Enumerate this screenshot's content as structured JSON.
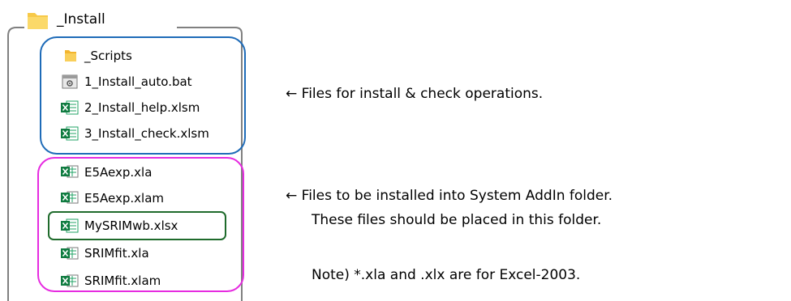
{
  "folder": {
    "name": "_Install",
    "icon": "folder-icon",
    "folder_color": "#F7C948"
  },
  "files": [
    {
      "name": "_Scripts",
      "icon": "folder-icon",
      "type": "folder"
    },
    {
      "name": "1_Install_auto.bat",
      "icon": "batch-file-icon",
      "type": "bat"
    },
    {
      "name": "2_Install_help.xlsm",
      "icon": "excel-macro-icon",
      "type": "xlsm"
    },
    {
      "name": "3_Install_check.xlsm",
      "icon": "excel-macro-icon",
      "type": "xlsm"
    },
    {
      "name": "E5Aexp.xla",
      "icon": "excel-addin-icon",
      "type": "xla"
    },
    {
      "name": "E5Aexp.xlam",
      "icon": "excel-addin-icon",
      "type": "xlam"
    },
    {
      "name": "MySRIMwb.xlsx",
      "icon": "excel-workbook-icon",
      "type": "xlsx"
    },
    {
      "name": "SRIMfit.xla",
      "icon": "excel-addin-icon",
      "type": "xla"
    },
    {
      "name": "SRIMfit.xlam",
      "icon": "excel-addin-icon",
      "type": "xlam"
    }
  ],
  "groups": {
    "install_check": {
      "color": "#1E6BB8"
    },
    "addin": {
      "color": "#E62BE0"
    },
    "workbook": {
      "color": "#1F6B2C"
    },
    "outer": {
      "color": "#808080"
    }
  },
  "notes": {
    "install_check": "← Files for install & check operations.",
    "addin_line1": "← Files to be installed into System AddIn folder.",
    "addin_line2": "These files should be placed in this folder.",
    "excel_note": "Note) *.xla and .xlx are for Excel-2003."
  }
}
